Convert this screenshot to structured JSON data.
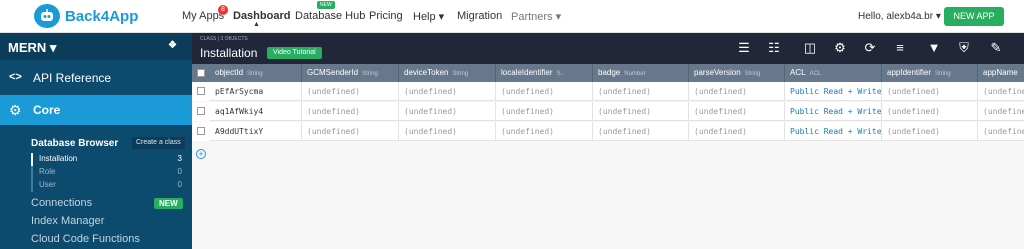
{
  "brand": {
    "name": "Back4App"
  },
  "nav": {
    "my_apps": "My Apps",
    "my_apps_count": "8",
    "dashboard": "Dashboard",
    "database_hub": "Database Hub",
    "database_hub_tag": "NEW",
    "pricing": "Pricing",
    "help": "Help ▾",
    "migration": "Migration",
    "partners": "Partners ▾",
    "hello": "Hello, alexb4a.br ▾",
    "new_app": "NEW APP"
  },
  "sidebar": {
    "app_name": "MERN ▾",
    "api_reference": "API Reference",
    "core": "Core",
    "database_browser": "Database Browser",
    "create_class": "Create a class",
    "classes": [
      {
        "name": "Installation",
        "count": "3"
      },
      {
        "name": "Role",
        "count": "0"
      },
      {
        "name": "User",
        "count": "0"
      }
    ],
    "connections": "Connections",
    "connections_tag": "NEW",
    "index_manager": "Index Manager",
    "cloud_code": "Cloud Code Functions"
  },
  "toolbar": {
    "subtitle": "CLASS | 3 OBJECTS",
    "class_name": "Installation",
    "video_tutorial": "Video Tutorial"
  },
  "columns": [
    {
      "name": "objectId",
      "type": "String"
    },
    {
      "name": "GCMSenderId",
      "type": "String"
    },
    {
      "name": "deviceToken",
      "type": "String"
    },
    {
      "name": "localeIdentifier",
      "type": "S.."
    },
    {
      "name": "badge",
      "type": "Number"
    },
    {
      "name": "parseVersion",
      "type": "String"
    },
    {
      "name": "ACL",
      "type": "ACL"
    },
    {
      "name": "appIdentifier",
      "type": "String"
    },
    {
      "name": "appName",
      "type": ""
    }
  ],
  "rows": [
    {
      "objectId": "pEfArSycma",
      "cells": [
        "(undefined)",
        "(undefined)",
        "(undefined)",
        "(undefined)",
        "(undefined)",
        "Public Read + Write",
        "(undefined)",
        "(undefine"
      ]
    },
    {
      "objectId": "aq1AfWkiy4",
      "cells": [
        "(undefined)",
        "(undefined)",
        "(undefined)",
        "(undefined)",
        "(undefined)",
        "Public Read + Write",
        "(undefined)",
        "(undefine"
      ]
    },
    {
      "objectId": "A9ddUTtixY",
      "cells": [
        "(undefined)",
        "(undefined)",
        "(undefined)",
        "(undefined)",
        "(undefined)",
        "Public Read + Write",
        "(undefined)",
        "(undefine"
      ]
    }
  ],
  "colors": {
    "accent": "#1a9ad6",
    "green": "#27ae60",
    "sidebar": "#0c4b6e",
    "toolbar": "#212639",
    "header": "#67788c"
  }
}
